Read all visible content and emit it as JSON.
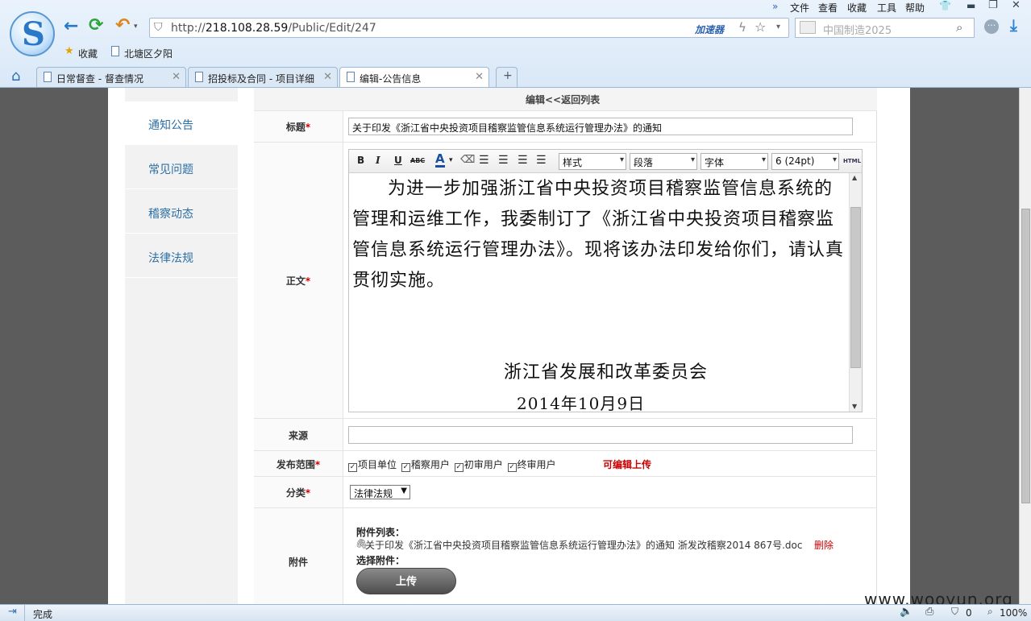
{
  "browser": {
    "menu": [
      "文件",
      "查看",
      "收藏",
      "工具",
      "帮助"
    ],
    "url_prefix": "http://",
    "url_host": "218.108.28.59",
    "url_path": "/Public/Edit/247",
    "accelerator": "加速器",
    "search_placeholder": "中国制造2025",
    "bookmarks": [
      "收藏",
      "北塘区夕阳"
    ],
    "tabs": [
      "日常督查 - 督查情况",
      "招投标及合同 - 项目详细",
      "编辑-公告信息"
    ],
    "new_tab": "+",
    "status_text": "完成",
    "status_count": "0",
    "zoom": "100%"
  },
  "sidebar": {
    "items": [
      "通知公告",
      "常见问题",
      "稽察动态",
      "法律法规"
    ]
  },
  "form": {
    "header": "编辑<<返回列表",
    "title_label": "标题",
    "title_value": "关于印发《浙江省中央投资项目稽察监管信息系统运行管理办法》的通知",
    "body_label": "正文",
    "body_paragraph": "为进一步加强浙江省中央投资项目稽察监管信息系统的管理和运维工作，我委制订了《浙江省中央投资项目稽察监管信息系统运行管理办法》。现将该办法印发给你们，请认真贯彻实施。",
    "body_org": "浙江省发展和改革委员会",
    "body_date": "2014年10月9日",
    "source_label": "来源",
    "source_value": "",
    "scope_label": "发布范围",
    "scope_options": [
      "项目单位",
      "稽察用户",
      "初审用户",
      "终审用户"
    ],
    "editable_note": "可编辑上传",
    "category_label": "分类",
    "category_value": "法律法规",
    "attach_label": "附件",
    "attach_list_label": "附件列表：",
    "attach_file": "关于印发《浙江省中央投资项目稽察监管信息系统运行管理办法》的通知 浙发改稽察2014 867号.doc",
    "attach_delete": "删除",
    "attach_choose_label": "选择附件：",
    "upload_label": "上传",
    "required_mark": "*"
  },
  "editor": {
    "style_select": "样式",
    "paragraph_select": "段落",
    "font_select": "字体",
    "size_select": "6 (24pt)",
    "html_label": "HTML"
  },
  "watermark": "www.wooyun.org",
  "colors": {
    "link": "#2b6ea4",
    "required": "#cc0000",
    "page_bg": "#5c5c5c"
  }
}
